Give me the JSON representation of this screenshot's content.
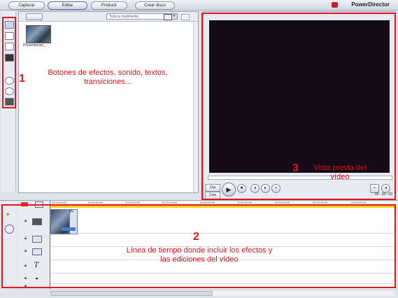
{
  "top_tabs": {
    "capturar": "Capturar",
    "editar": "Editar",
    "producir": "Producir",
    "crear_disco": "Crear disco"
  },
  "brand": "PowerDirector",
  "library": {
    "filter_value": "Toda la multimedia",
    "items": [
      {
        "label": "Presentacion_..."
      }
    ]
  },
  "preview": {
    "mode_clip": "Clip",
    "mode_cine": "Cine",
    "timecode": "00 : 00 : 00"
  },
  "timeline": {
    "ruler_ticks": [
      "00:00:00:00",
      "00:00:30:00",
      "00:01:00:00",
      "00:01:30:00",
      "00:02:00:00",
      "00:02:30:00",
      "00:03:00:00",
      "00:03:30:00",
      "00:04:00:00"
    ],
    "clip_label": "Pr",
    "title_track_icon": "T"
  },
  "annotations": {
    "n1": "1",
    "t1": "Botones de efectos, sonido, textos, transiciones...",
    "n2": "2",
    "t2": "Línea de tiempo donde incluir los efectos y las ediciones del vídeo",
    "n3": "3",
    "t3": "Vista previa del vídeo"
  },
  "colors": {
    "annotation": "#e8161b",
    "preview_screen": "#150a17",
    "timeline_marker": "#f4d21a"
  },
  "icons": [
    "media-icon",
    "image-icon",
    "effects-icon",
    "video-icon",
    "audio-icon",
    "transition-icon",
    "titles-icon",
    "lock-icon",
    "folder-icon",
    "play-icon",
    "stop-icon"
  ]
}
